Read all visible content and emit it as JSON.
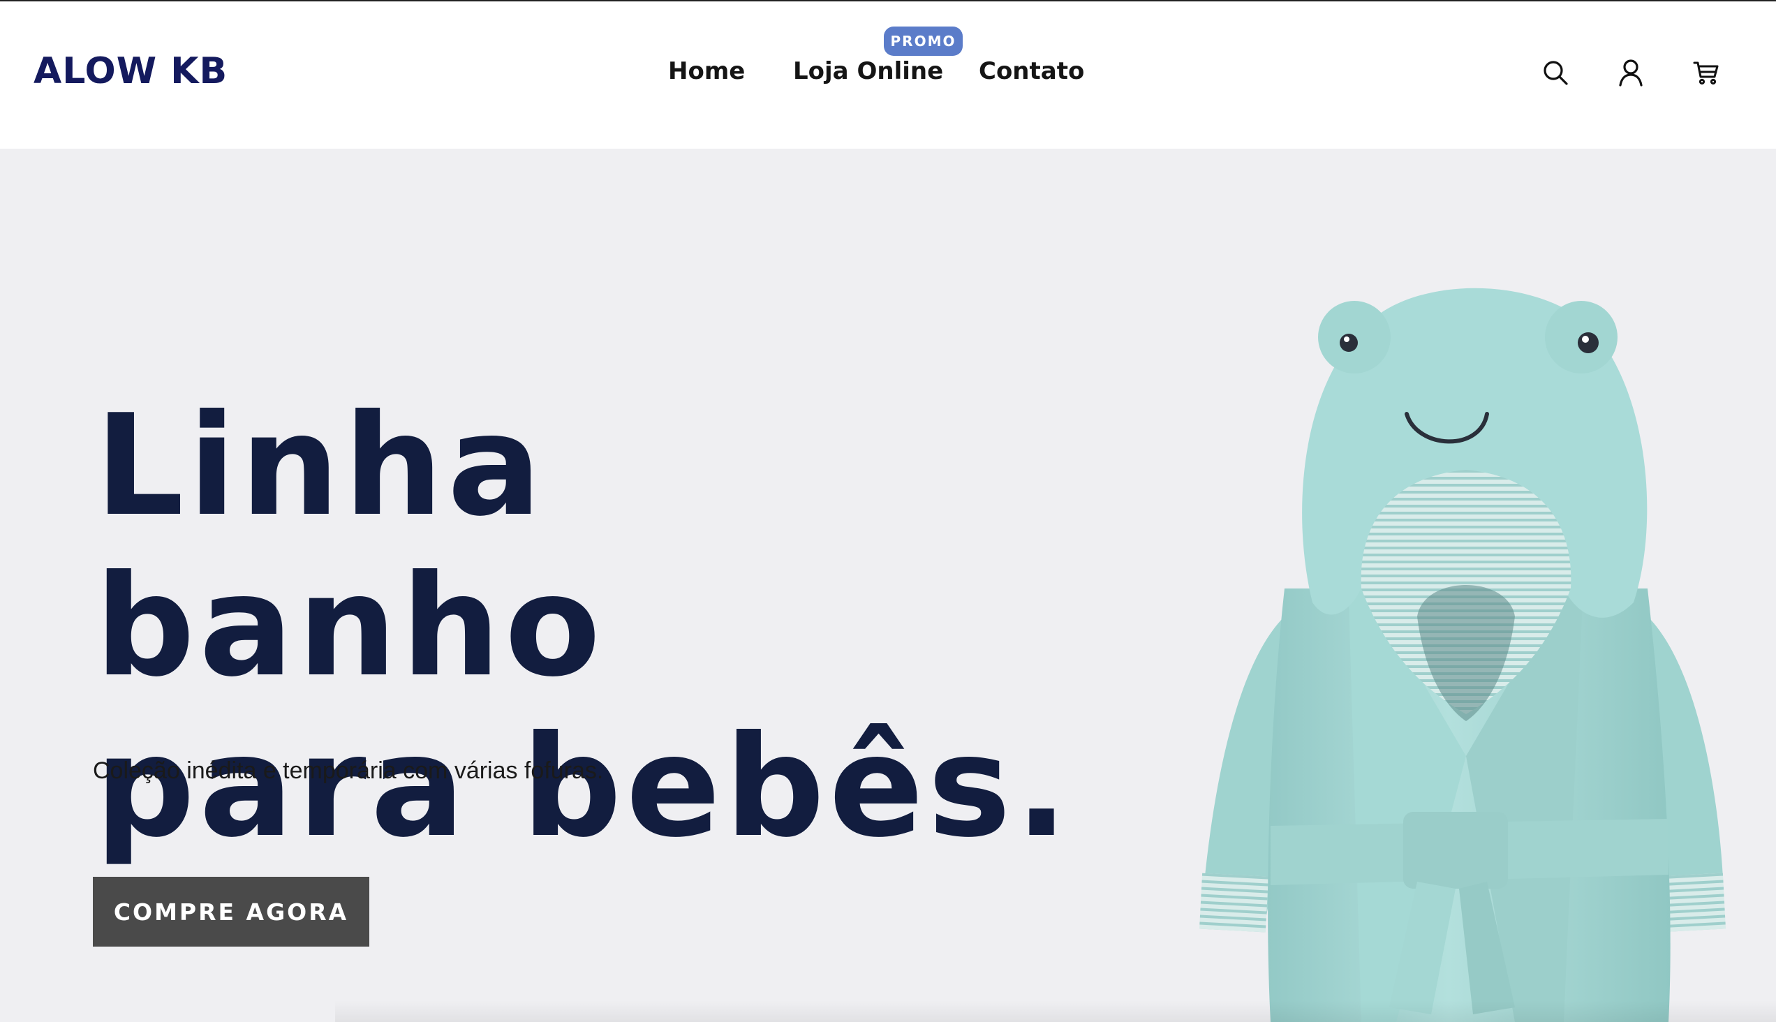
{
  "brand": {
    "logo_text": "ALOW KB"
  },
  "nav": {
    "items": [
      {
        "label": "Home"
      },
      {
        "label": "Loja Online",
        "badge": "PROMO"
      },
      {
        "label": "Contato"
      }
    ]
  },
  "header_icons": [
    "search-icon",
    "account-icon",
    "cart-icon"
  ],
  "hero": {
    "title_line1": "Linha banho",
    "title_line2": "para bebês.",
    "subtitle": "Coleção inédita e temporária com várias fofuras.",
    "cta_label": "COMPRE AGORA",
    "image": "frog-hooded-bathrobe"
  },
  "colors": {
    "brand": "#141a5e",
    "title": "#121d3f",
    "promo_badge": "#5b7cc9",
    "cta_bg": "#4a4a4a",
    "hero_bg": "#efeff2",
    "robe": "#a8d8d6"
  }
}
